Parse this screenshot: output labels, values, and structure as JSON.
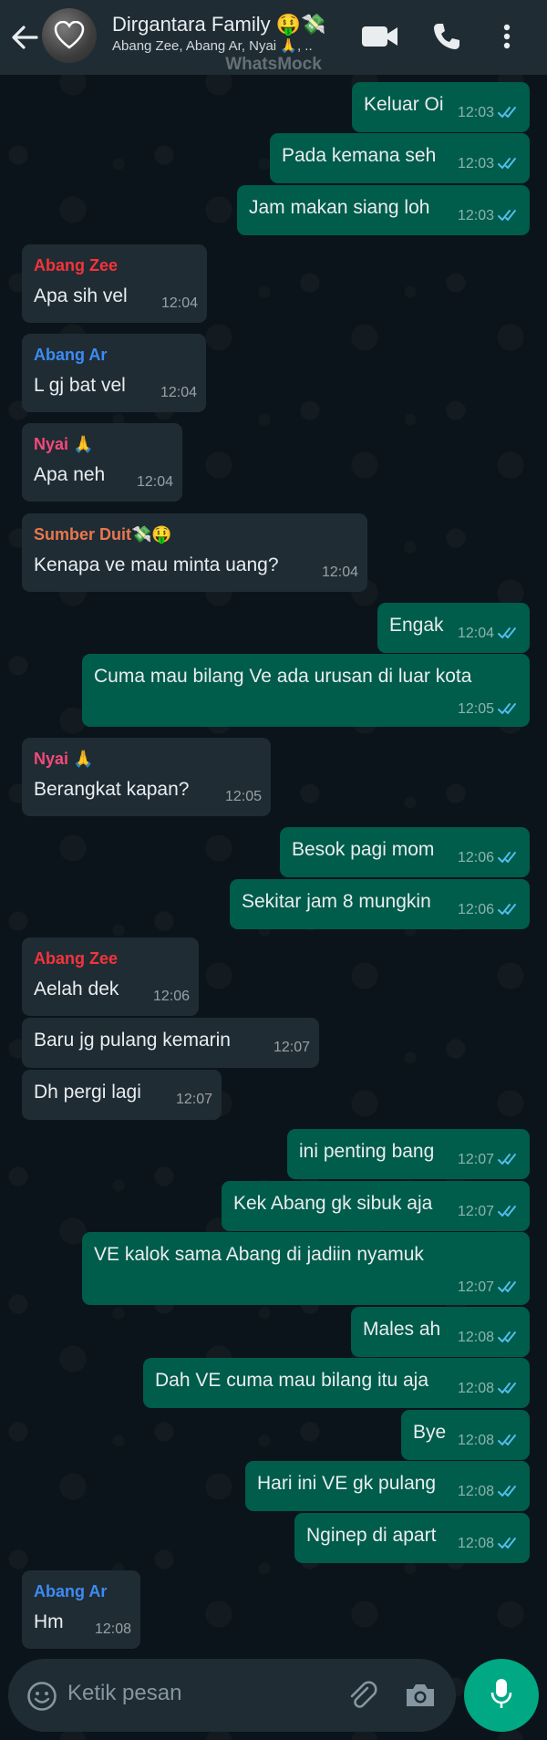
{
  "header": {
    "title": "Dirgantara Family 🤑💸",
    "subtitle": "Abang Zee, Abang Ar, Nyai 🙏, ..",
    "watermark": "WhatsMock"
  },
  "messages": [
    {
      "dir": "out",
      "text": "Keluar Oi",
      "time": "12:03"
    },
    {
      "dir": "out",
      "text": "Pada kemana seh",
      "time": "12:03"
    },
    {
      "dir": "out",
      "text": "Jam makan siang loh",
      "time": "12:03"
    },
    {
      "dir": "in",
      "sender": "Abang Zee",
      "text": "Apa sih vel",
      "time": "12:04"
    },
    {
      "dir": "in",
      "sender": "Abang Ar",
      "text": "L gj bat vel",
      "time": "12:04"
    },
    {
      "dir": "in",
      "sender": "Nyai 🙏",
      "text": "Apa neh",
      "time": "12:04"
    },
    {
      "dir": "in",
      "sender": "Sumber Duit💸🤑",
      "text": "Kenapa ve mau minta uang?",
      "time": "12:04"
    },
    {
      "dir": "out",
      "text": "Engak",
      "time": "12:04"
    },
    {
      "dir": "out",
      "text": "Cuma mau bilang Ve ada urusan di luar kota",
      "time": "12:05"
    },
    {
      "dir": "in",
      "sender": "Nyai 🙏",
      "text": "Berangkat kapan?",
      "time": "12:05"
    },
    {
      "dir": "out",
      "text": "Besok pagi mom",
      "time": "12:06"
    },
    {
      "dir": "out",
      "text": "Sekitar jam 8 mungkin",
      "time": "12:06"
    },
    {
      "dir": "in",
      "sender": "Abang Zee",
      "text": "Aelah dek",
      "time": "12:06"
    },
    {
      "dir": "in",
      "text": "Baru jg pulang kemarin",
      "time": "12:07"
    },
    {
      "dir": "in",
      "text": "Dh pergi lagi",
      "time": "12:07"
    },
    {
      "dir": "out",
      "text": "ini penting bang",
      "time": "12:07"
    },
    {
      "dir": "out",
      "text": "Kek Abang gk sibuk aja",
      "time": "12:07"
    },
    {
      "dir": "out",
      "text": "VE kalok sama Abang di jadiin nyamuk",
      "time": "12:07"
    },
    {
      "dir": "out",
      "text": "Males ah",
      "time": "12:08"
    },
    {
      "dir": "out",
      "text": "Dah VE cuma mau bilang itu aja",
      "time": "12:08"
    },
    {
      "dir": "out",
      "text": "Bye",
      "time": "12:08"
    },
    {
      "dir": "out",
      "text": "Hari ini VE gk pulang",
      "time": "12:08"
    },
    {
      "dir": "out",
      "text": "Nginep di apart",
      "time": "12:08"
    },
    {
      "dir": "in",
      "sender": "Abang Ar",
      "text": "Hm",
      "time": "12:08"
    }
  ],
  "sender_colors": {
    "Abang Zee": "#f6333a",
    "Abang Ar": "#3d8bf2",
    "Nyai 🙏": "#f5497a",
    "Sumber Duit💸🤑": "#e9774d"
  },
  "colors": {
    "outgoing_bubble": "#005c4b",
    "incoming_bubble": "#1f2c34",
    "header": "#1f2c34",
    "accent": "#00a884",
    "read_ticks": "#53bdeb"
  },
  "composer": {
    "placeholder": "Ketik pesan"
  },
  "icons": {
    "back": "arrow-left",
    "video": "video-camera",
    "call": "phone",
    "menu": "three-dots-vertical",
    "emoji": "smiley",
    "attach": "paperclip",
    "camera": "camera",
    "mic": "microphone"
  }
}
